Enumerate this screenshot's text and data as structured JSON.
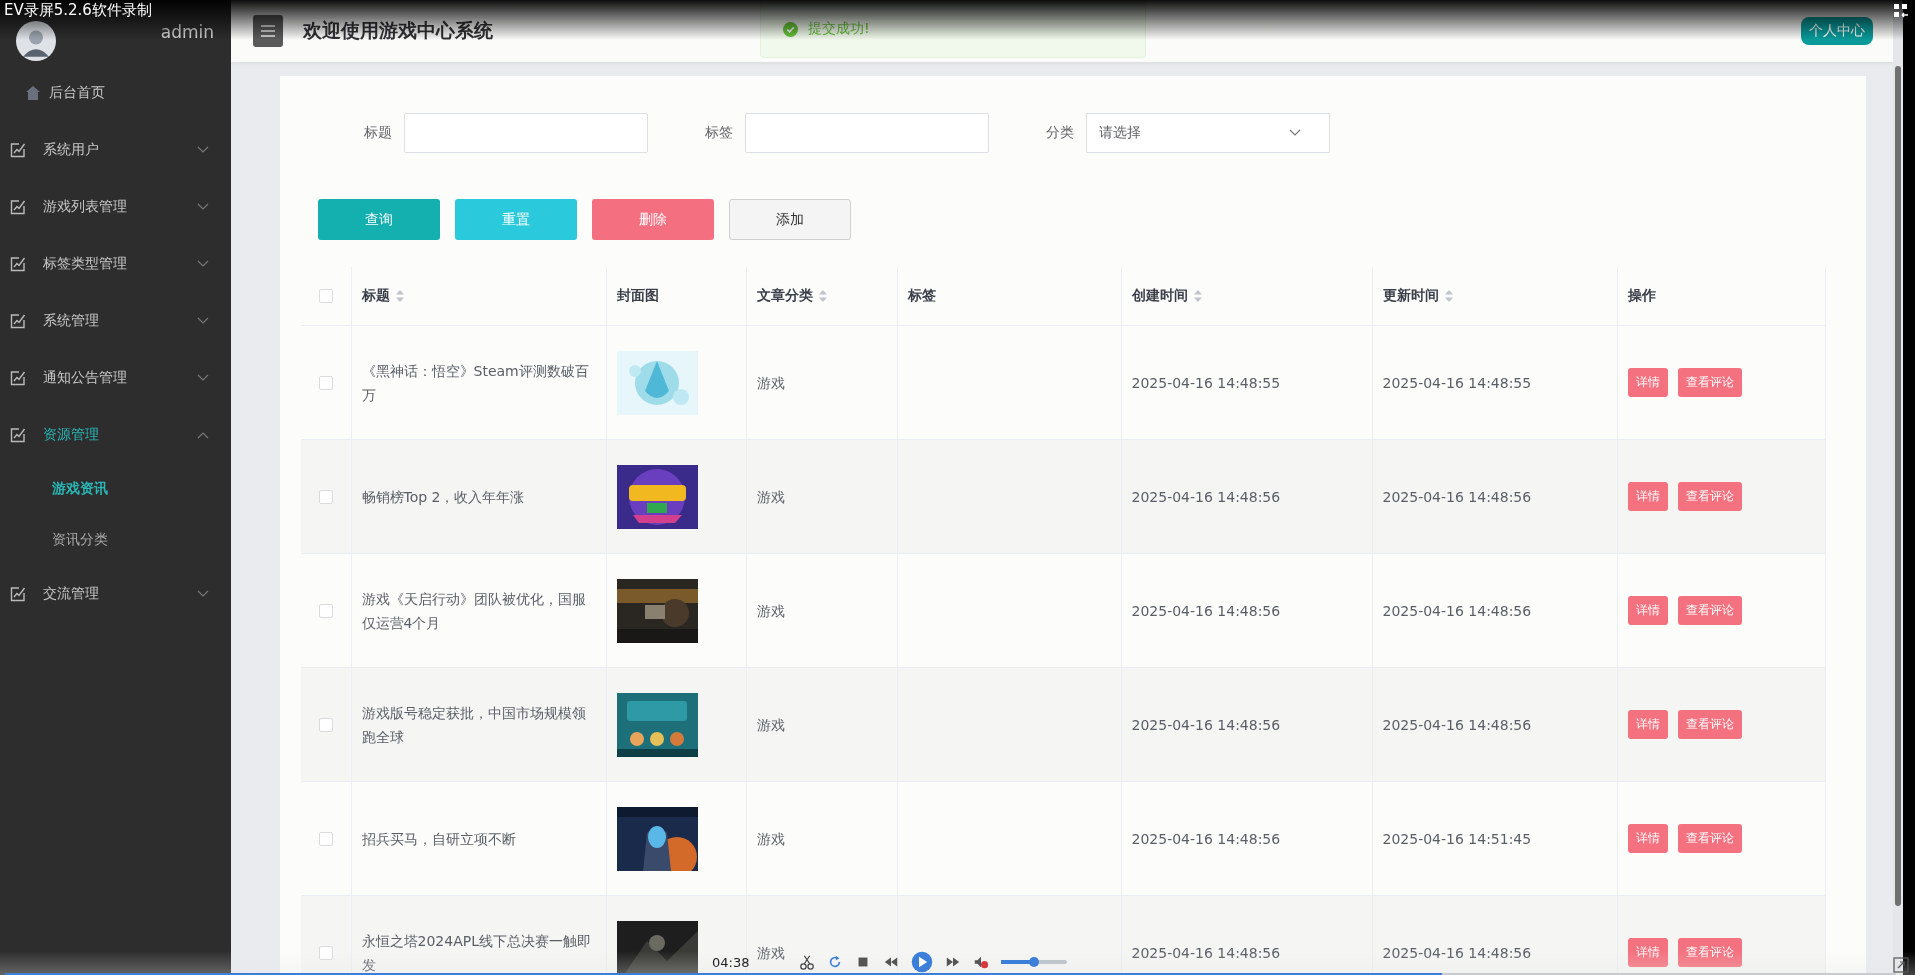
{
  "recorder": {
    "caption": "EV录屏5.2.6软件录制",
    "progress": {
      "level": 0.76
    },
    "time": "04:38",
    "volume": {
      "level": 0.5
    }
  },
  "sidebar": {
    "user": "admin",
    "items": [
      {
        "kind": "link",
        "label": "后台首页",
        "selected": false
      },
      {
        "kind": "group",
        "label": "系统用户",
        "expanded": false,
        "selected": false
      },
      {
        "kind": "group",
        "label": "游戏列表管理",
        "expanded": false,
        "selected": false
      },
      {
        "kind": "group",
        "label": "标签类型管理",
        "expanded": false,
        "selected": false
      },
      {
        "kind": "group",
        "label": "系统管理",
        "expanded": false,
        "selected": false
      },
      {
        "kind": "group",
        "label": "通知公告管理",
        "expanded": false,
        "selected": false
      },
      {
        "kind": "group",
        "label": "资源管理",
        "expanded": true,
        "selected": true,
        "children": [
          {
            "label": "游戏资讯",
            "selected": true
          },
          {
            "label": "资讯分类",
            "selected": false
          }
        ]
      },
      {
        "kind": "group",
        "label": "交流管理",
        "expanded": false,
        "selected": false
      }
    ]
  },
  "header": {
    "title": "欢迎使用游戏中心系统",
    "profile_button": "个人中心"
  },
  "toast": {
    "kind": "success",
    "message": "提交成功!"
  },
  "filters": [
    {
      "kind": "text",
      "label": "标题"
    },
    {
      "kind": "text",
      "label": "标签"
    },
    {
      "kind": "select",
      "label": "分类",
      "placeholder": "请选择"
    }
  ],
  "buttons": [
    {
      "kind": "primary",
      "label": "查询"
    },
    {
      "kind": "info",
      "label": "重置"
    },
    {
      "kind": "danger",
      "label": "删除"
    },
    {
      "kind": "default",
      "label": "添加"
    }
  ],
  "table": {
    "select_all": {
      "checked": false
    },
    "columns": [
      {
        "label": "标题",
        "sortable": true
      },
      {
        "label": "封面图",
        "sortable": false
      },
      {
        "label": "文章分类",
        "sortable": true
      },
      {
        "label": "标签",
        "sortable": false
      },
      {
        "label": "创建时间",
        "sortable": true
      },
      {
        "label": "更新时间",
        "sortable": true
      },
      {
        "label": "操作",
        "sortable": false
      }
    ],
    "rows": [
      {
        "checked": false,
        "title": "《黑神话：悟空》Steam评测数破百万",
        "cover": {
          "kind": "picture"
        },
        "category": "游戏",
        "created": "2025-04-16 14:48:55",
        "updated": "2025-04-16 14:48:55",
        "actions": [
          "详情",
          "查看评论"
        ]
      },
      {
        "checked": false,
        "title": "畅销榜Top 2，收入年年涨",
        "cover": {
          "kind": "picture"
        },
        "category": "游戏",
        "created": "2025-04-16 14:48:56",
        "updated": "2025-04-16 14:48:56",
        "actions": [
          "详情",
          "查看评论"
        ]
      },
      {
        "checked": false,
        "title": "游戏《天启行动》团队被优化，国服仅运营4个月",
        "cover": {
          "kind": "picture"
        },
        "category": "游戏",
        "created": "2025-04-16 14:48:56",
        "updated": "2025-04-16 14:48:56",
        "actions": [
          "详情",
          "查看评论"
        ]
      },
      {
        "checked": false,
        "title": "游戏版号稳定获批，中国市场规模领跑全球",
        "cover": {
          "kind": "picture"
        },
        "category": "游戏",
        "created": "2025-04-16 14:48:56",
        "updated": "2025-04-16 14:48:56",
        "actions": [
          "详情",
          "查看评论"
        ]
      },
      {
        "checked": false,
        "title": "招兵买马，自研立项不断",
        "cover": {
          "kind": "picture"
        },
        "category": "游戏",
        "created": "2025-04-16 14:48:56",
        "updated": "2025-04-16 14:51:45",
        "actions": [
          "详情",
          "查看评论"
        ]
      },
      {
        "checked": false,
        "title": "永恒之塔2024APL线下总决赛一触即发",
        "cover": {
          "kind": "picture"
        },
        "category": "游戏",
        "created": "2025-04-16 14:48:56",
        "updated": "2025-04-16 14:48:56",
        "actions": [
          "详情",
          "查看评论"
        ]
      }
    ]
  }
}
